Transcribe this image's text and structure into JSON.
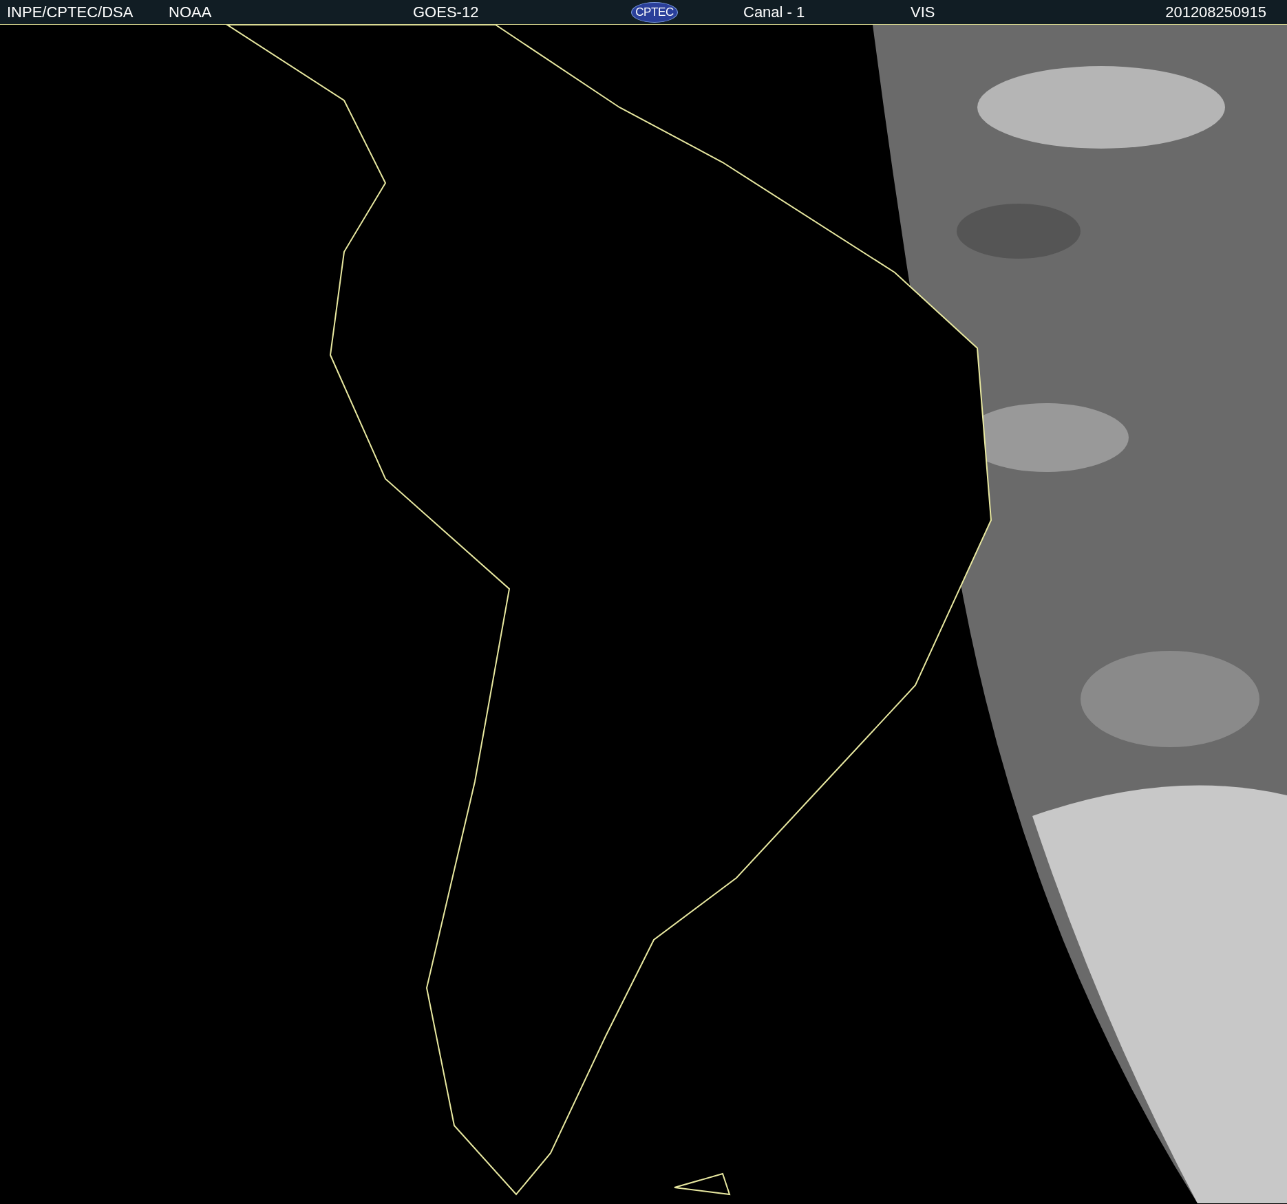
{
  "header": {
    "source": "INPE/CPTEC/DSA",
    "agency": "NOAA",
    "satellite": "GOES-12",
    "logo": "CPTEC",
    "channel": "Canal - 1",
    "band": "VIS",
    "timestamp": "201208250915"
  }
}
